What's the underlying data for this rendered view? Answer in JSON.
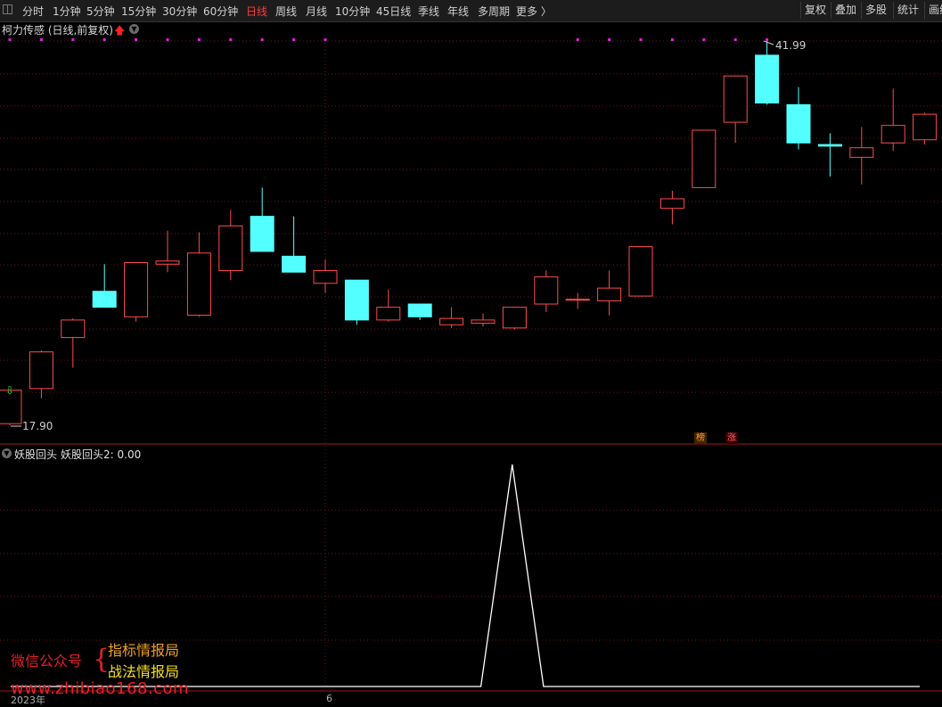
{
  "toolbar": {
    "items": [
      {
        "label": "分时",
        "active": false
      },
      {
        "label": "1分钟",
        "active": false
      },
      {
        "label": "5分钟",
        "active": false
      },
      {
        "label": "15分钟",
        "active": false
      },
      {
        "label": "30分钟",
        "active": false
      },
      {
        "label": "60分钟",
        "active": false
      },
      {
        "label": "日线",
        "active": true
      },
      {
        "label": "周线",
        "active": false
      },
      {
        "label": "月线",
        "active": false
      },
      {
        "label": "10分钟",
        "active": false
      },
      {
        "label": "45日线",
        "active": false
      },
      {
        "label": "季线",
        "active": false
      },
      {
        "label": "年线",
        "active": false
      },
      {
        "label": "多周期",
        "active": false
      },
      {
        "label": "更多 〉",
        "active": false
      }
    ],
    "right_buttons": [
      "复权",
      "叠加",
      "多股",
      "统计",
      "画线"
    ]
  },
  "main_chart": {
    "title": "柯力传感 (日线,前复权)",
    "high_label": "41.99",
    "low_label": "17.90",
    "tags": {
      "bang": "榜",
      "zhang": "涨"
    }
  },
  "indicator": {
    "title": "妖股回头",
    "value_label": "妖股回头2: 0.00"
  },
  "x_axis": {
    "year_label": "2023年",
    "tick_label": "6"
  },
  "watermark": {
    "left": "微信公众号",
    "brace": "{",
    "line1": "指标情报局",
    "line2": "战法情报局",
    "url": "www.zhibiao168.com"
  },
  "colors": {
    "up": "#ff4a4a",
    "down": "#54ffff",
    "grid": "#6e1414",
    "indicator_line": "#ffffff",
    "marker": "#e020e0"
  },
  "chart_data": {
    "type": "candlestick",
    "x": [
      "d1",
      "d2",
      "d3",
      "d4",
      "d5",
      "d6",
      "d7",
      "d8",
      "d9",
      "d10",
      "d11",
      "d12",
      "d13",
      "d14",
      "d15",
      "d16",
      "d17",
      "d18",
      "d19",
      "d20",
      "d21",
      "d22",
      "d23",
      "d24",
      "d25",
      "d26",
      "d27",
      "d28",
      "d29",
      "d30"
    ],
    "ohlc": [
      [
        18.0,
        20.1,
        17.9,
        20.1
      ],
      [
        20.2,
        22.6,
        19.6,
        22.5
      ],
      [
        23.4,
        24.6,
        21.5,
        24.5
      ],
      [
        26.3,
        28.0,
        25.4,
        25.3
      ],
      [
        24.7,
        27.5,
        24.4,
        28.1
      ],
      [
        28.0,
        30.1,
        27.5,
        28.2
      ],
      [
        24.8,
        30.0,
        24.7,
        28.7
      ],
      [
        27.6,
        31.4,
        27.0,
        30.4
      ],
      [
        31.0,
        32.8,
        28.9,
        28.8
      ],
      [
        28.5,
        31.0,
        27.5,
        27.5
      ],
      [
        26.8,
        28.3,
        26.2,
        27.6
      ],
      [
        27.0,
        27.0,
        24.2,
        24.5
      ],
      [
        24.5,
        26.4,
        24.4,
        25.3
      ],
      [
        25.5,
        25.5,
        24.5,
        24.7
      ],
      [
        24.2,
        25.3,
        24.0,
        24.6
      ],
      [
        24.3,
        24.9,
        24.1,
        24.5
      ],
      [
        24.0,
        25.0,
        23.9,
        25.3
      ],
      [
        25.5,
        27.6,
        25.0,
        27.2
      ],
      [
        25.8,
        26.2,
        25.2,
        25.8
      ],
      [
        25.7,
        27.6,
        24.8,
        26.5
      ],
      [
        26.0,
        29.0,
        26.0,
        29.1
      ],
      [
        31.5,
        32.6,
        30.5,
        32.1
      ],
      [
        32.8,
        36.4,
        32.8,
        36.4
      ],
      [
        36.9,
        39.5,
        35.6,
        39.8
      ],
      [
        41.1,
        41.99,
        38.0,
        38.1
      ],
      [
        38.0,
        39.1,
        35.2,
        35.6
      ],
      [
        35.5,
        36.2,
        33.5,
        35.4
      ],
      [
        34.7,
        36.6,
        33.0,
        35.3
      ],
      [
        35.6,
        39.0,
        35.1,
        36.7
      ],
      [
        35.8,
        37.5,
        35.5,
        37.4
      ]
    ],
    "indicator_series": {
      "name": "妖股回头2",
      "values": [
        0,
        0,
        0,
        0,
        0,
        0,
        0,
        0,
        0,
        0,
        0,
        0,
        0,
        0,
        0,
        0,
        1,
        0,
        0,
        0,
        0,
        0,
        0,
        0,
        0,
        0,
        0,
        0,
        0,
        0
      ]
    },
    "signal_markers_top": [
      1,
      1,
      1,
      1,
      1,
      1,
      1,
      1,
      1,
      1,
      1,
      0,
      0,
      0,
      0,
      0,
      0,
      0,
      1,
      1,
      1,
      1,
      1,
      1,
      1,
      0,
      0,
      0,
      0,
      0
    ]
  }
}
